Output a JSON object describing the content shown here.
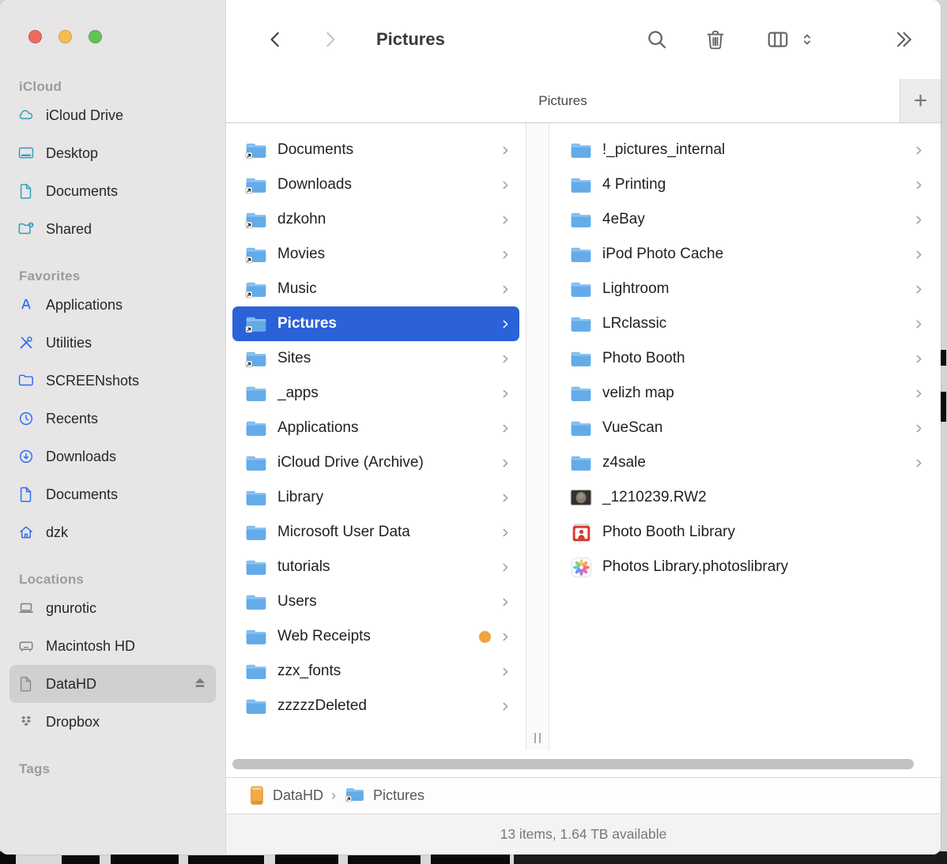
{
  "colors": {
    "accent_selection": "#2b62d8",
    "folder_blue": "#63abe9",
    "sidebar_bg": "#e7e5e6",
    "sidebar_selected": "#d1cfd0",
    "tag_orange": "#efa33e",
    "traffic": [
      "#ee6a5f",
      "#f5bd4f",
      "#61c554"
    ]
  },
  "toolbar": {
    "title": "Pictures",
    "back_icon": "chevron-left-icon",
    "forward_icon": "chevron-right-icon",
    "right_icons": [
      "search-icon",
      "trash-icon",
      "column-view-icon",
      "view-chooser-chevrons-icon",
      "more-toolbar-icon"
    ]
  },
  "tab_bar": {
    "active_tab": "Pictures",
    "new_tab_button": "+"
  },
  "sidebar": {
    "sections": [
      {
        "title": "iCloud",
        "tint": "#2f9fbc",
        "items": [
          {
            "label": "iCloud Drive",
            "icon": "cloud-icon"
          },
          {
            "label": "Desktop",
            "icon": "desktop-icon"
          },
          {
            "label": "Documents",
            "icon": "document-icon"
          },
          {
            "label": "Shared",
            "icon": "shared-folder-icon"
          }
        ]
      },
      {
        "title": "Favorites",
        "tint": "#2a6df4",
        "items": [
          {
            "label": "Applications",
            "icon": "applications-icon"
          },
          {
            "label": "Utilities",
            "icon": "utilities-icon"
          },
          {
            "label": "SCREENshots",
            "icon": "folder-icon"
          },
          {
            "label": "Recents",
            "icon": "clock-icon"
          },
          {
            "label": "Downloads",
            "icon": "download-icon"
          },
          {
            "label": "Documents",
            "icon": "document-icon"
          },
          {
            "label": "dzk",
            "icon": "home-icon"
          }
        ]
      },
      {
        "title": "Locations",
        "tint": "#7e7e83",
        "items": [
          {
            "label": "gnurotic",
            "icon": "laptop-icon"
          },
          {
            "label": "Macintosh HD",
            "icon": "hard-drive-icon"
          },
          {
            "label": "DataHD",
            "icon": "removable-disk-icon",
            "selected": true,
            "trailing": "eject-icon"
          },
          {
            "label": "Dropbox",
            "icon": "dropbox-icon"
          }
        ]
      },
      {
        "title": "Tags",
        "tint": "#7e7e83",
        "items": []
      }
    ]
  },
  "columns": {
    "middle": {
      "items": [
        {
          "name": "Documents",
          "icon": "folder-alias",
          "chevron": true
        },
        {
          "name": "Downloads",
          "icon": "folder-alias",
          "chevron": true
        },
        {
          "name": "dzkohn",
          "icon": "folder-alias",
          "chevron": true
        },
        {
          "name": "Movies",
          "icon": "folder-alias",
          "chevron": true
        },
        {
          "name": "Music",
          "icon": "folder-alias",
          "chevron": true
        },
        {
          "name": "Pictures",
          "icon": "folder-alias",
          "chevron": true,
          "selected": true
        },
        {
          "name": "Sites",
          "icon": "folder-alias",
          "chevron": true
        },
        {
          "name": "_apps",
          "icon": "folder",
          "chevron": true
        },
        {
          "name": "Applications",
          "icon": "folder",
          "chevron": true
        },
        {
          "name": "iCloud Drive (Archive)",
          "icon": "folder",
          "chevron": true
        },
        {
          "name": "Library",
          "icon": "folder",
          "chevron": true
        },
        {
          "name": "Microsoft User Data",
          "icon": "folder",
          "chevron": true
        },
        {
          "name": "tutorials",
          "icon": "folder",
          "chevron": true
        },
        {
          "name": "Users",
          "icon": "folder",
          "chevron": true
        },
        {
          "name": "Web Receipts",
          "icon": "folder",
          "chevron": true,
          "tag_color": "#efa33e"
        },
        {
          "name": "zzx_fonts",
          "icon": "folder",
          "chevron": true
        },
        {
          "name": "zzzzzDeleted",
          "icon": "folder",
          "chevron": true
        }
      ]
    },
    "right": {
      "items": [
        {
          "name": "!_pictures_internal",
          "icon": "folder",
          "chevron": true
        },
        {
          "name": "4 Printing",
          "icon": "folder",
          "chevron": true
        },
        {
          "name": "4eBay",
          "icon": "folder",
          "chevron": true
        },
        {
          "name": "iPod Photo Cache",
          "icon": "folder",
          "chevron": true
        },
        {
          "name": "Lightroom",
          "icon": "folder",
          "chevron": true
        },
        {
          "name": "LRclassic",
          "icon": "folder",
          "chevron": true
        },
        {
          "name": "Photo Booth",
          "icon": "folder",
          "chevron": true
        },
        {
          "name": "velizh map",
          "icon": "folder",
          "chevron": true
        },
        {
          "name": "VueScan",
          "icon": "folder",
          "chevron": true
        },
        {
          "name": "z4sale",
          "icon": "folder",
          "chevron": true
        },
        {
          "name": "_1210239.RW2",
          "icon": "raw-image-thumbnail",
          "chevron": false
        },
        {
          "name": "Photo Booth Library",
          "icon": "photo-booth-library-icon",
          "chevron": false
        },
        {
          "name": "Photos Library.photoslibrary",
          "icon": "photos-app-icon",
          "chevron": false
        }
      ]
    }
  },
  "path_bar": {
    "separator": "›",
    "items": [
      {
        "label": "DataHD",
        "icon": "external-drive-icon"
      },
      {
        "label": "Pictures",
        "icon": "folder-alias"
      }
    ]
  },
  "status_bar": {
    "text": "13 items, 1.64 TB available"
  }
}
